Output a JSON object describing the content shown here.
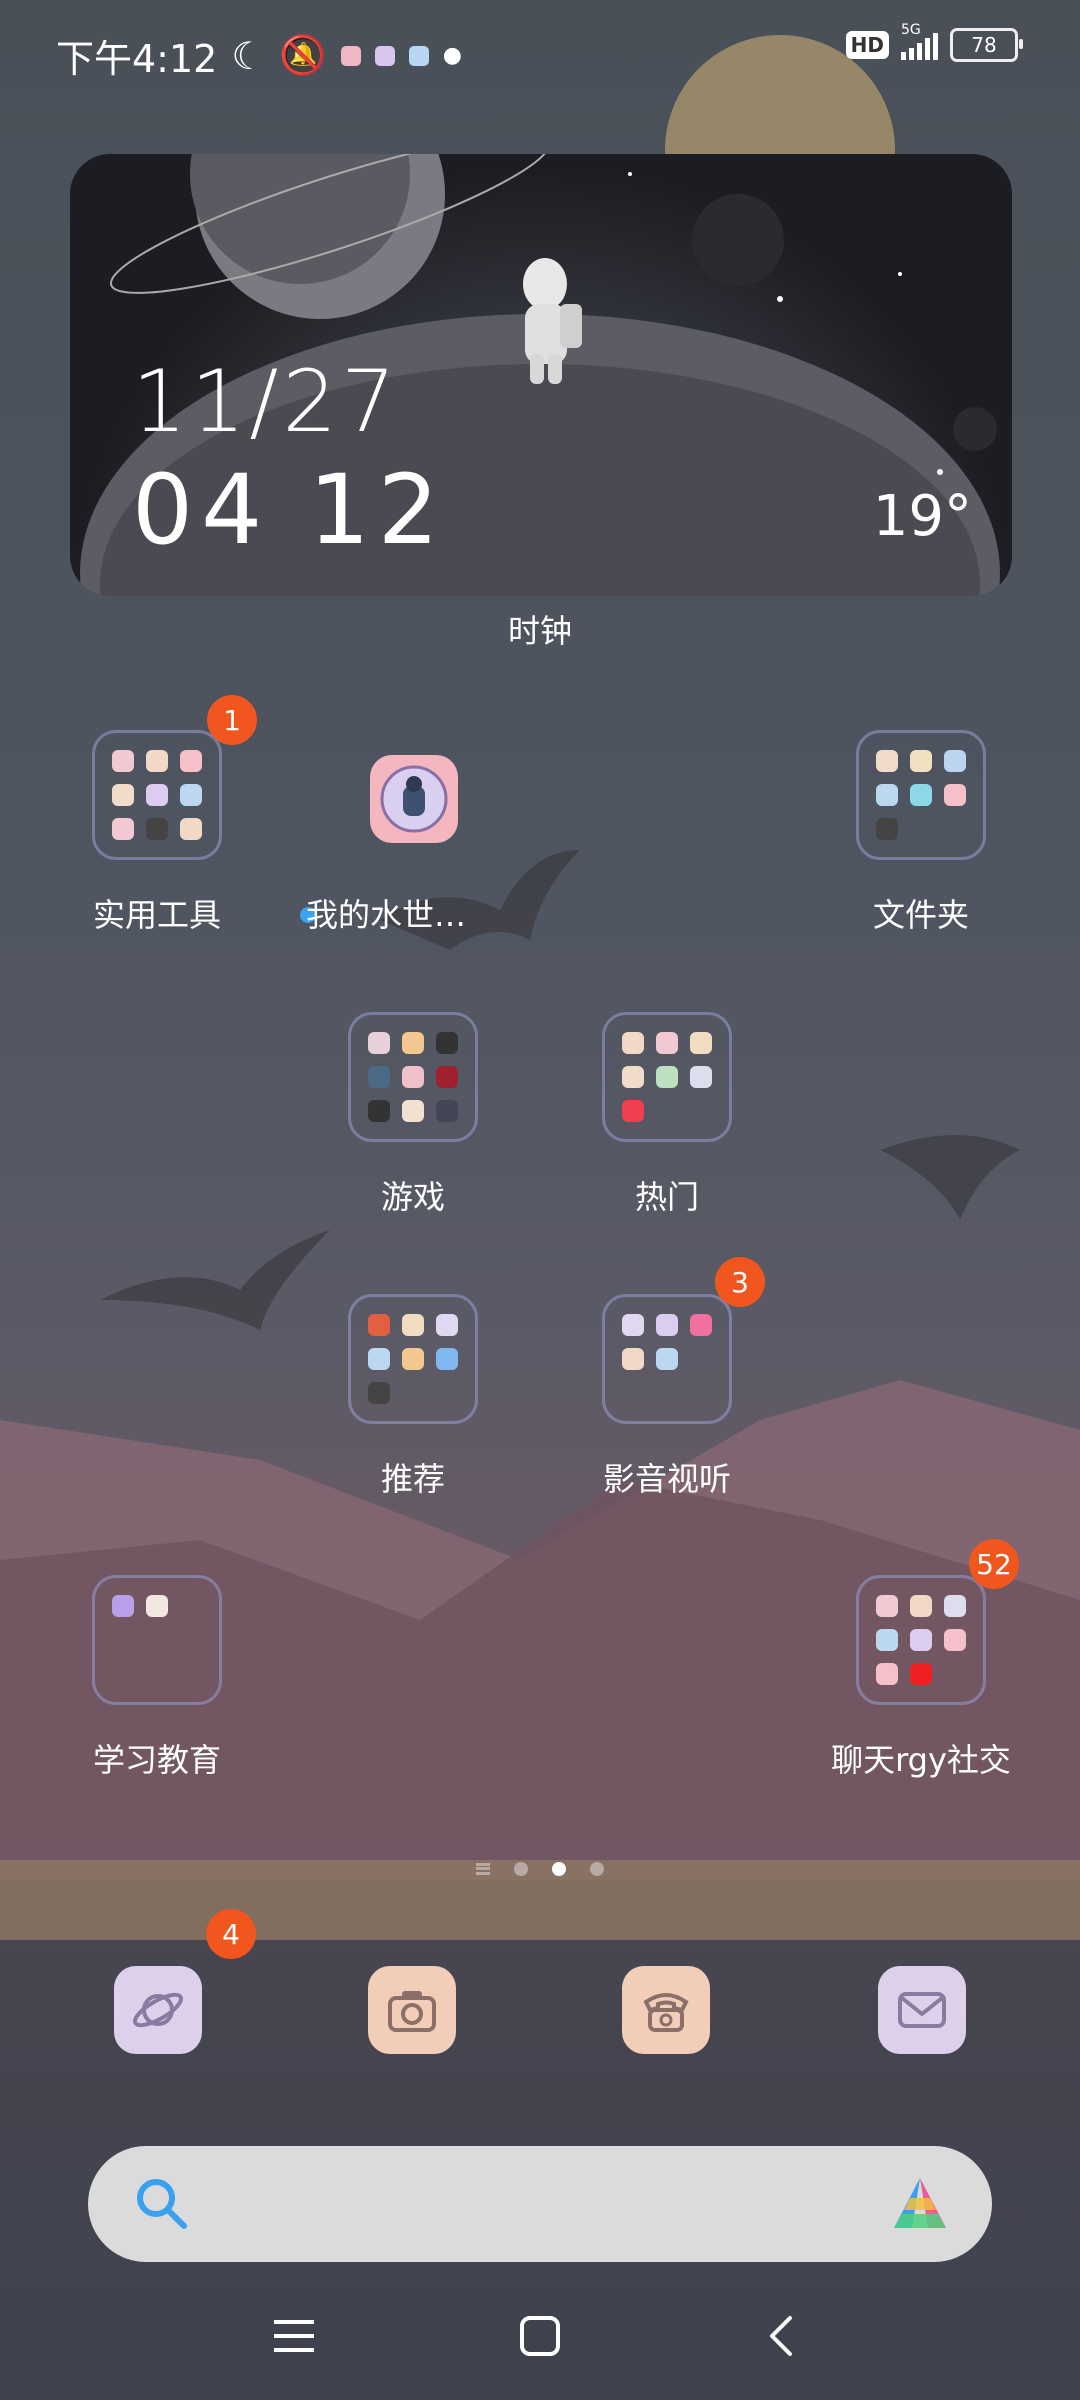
{
  "status_bar": {
    "time": "下午4:12",
    "network": "5G",
    "hd": "HD",
    "battery": "78"
  },
  "clock_widget": {
    "date": "11/27",
    "time": "04 12",
    "temperature": "19°",
    "label": "时钟"
  },
  "apps": {
    "tools_folder": {
      "label": "实用工具",
      "badge": "1"
    },
    "water_app": {
      "label": "我的水世…"
    },
    "files_folder": {
      "label": "文件夹"
    },
    "games_folder": {
      "label": "游戏"
    },
    "hot_folder": {
      "label": "热门"
    },
    "recommend_folder": {
      "label": "推荐"
    },
    "media_folder": {
      "label": "影音视听",
      "badge": "3"
    },
    "edu_folder": {
      "label": "学习教育"
    },
    "social_folder": {
      "label": "聊天rgy社交",
      "badge": "52"
    }
  },
  "dock": {
    "browser_badge": "4"
  },
  "colors": {
    "badge": "#f0561e",
    "dock_lavender": "#dcd0ea",
    "dock_peach": "#f2cdb8"
  }
}
